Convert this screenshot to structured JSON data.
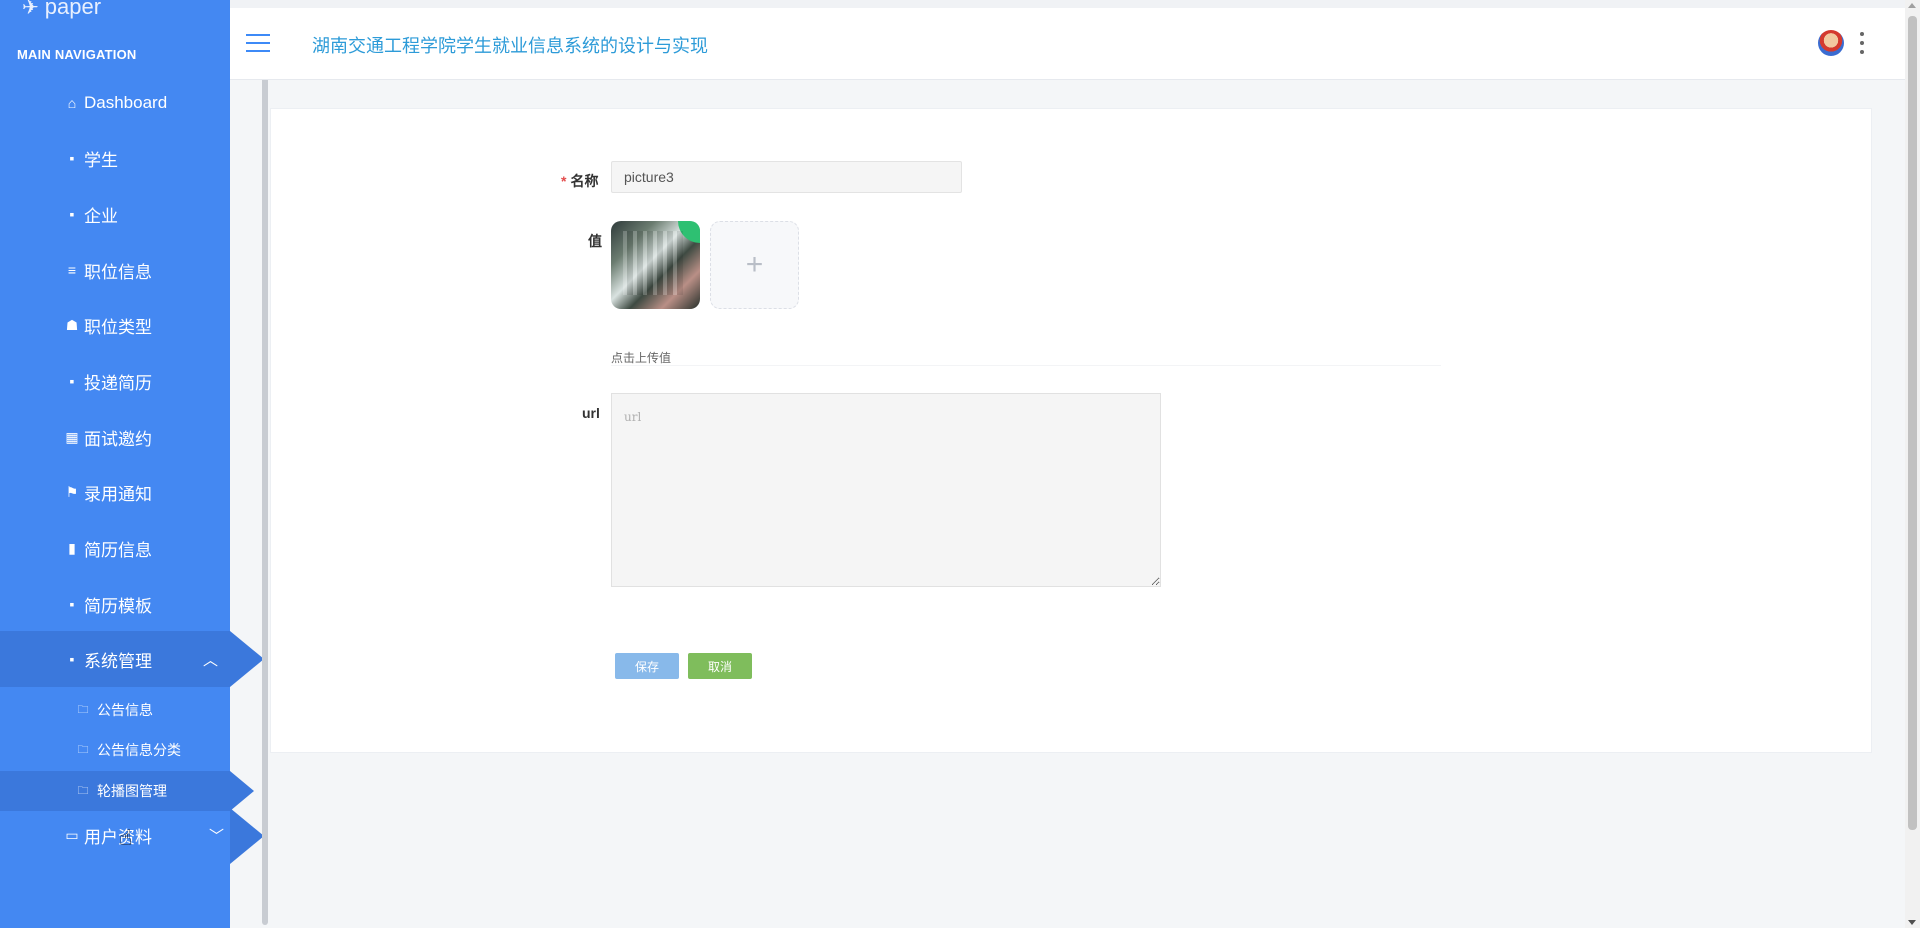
{
  "app": {
    "logo_text": "paper",
    "title": "湖南交通工程学院学生就业信息系统的设计与实现"
  },
  "sidebar": {
    "section_title": "MAIN NAVIGATION",
    "items": [
      {
        "label": "Dashboard",
        "icon": "home-icon"
      },
      {
        "label": "学生",
        "icon": "grid-icon"
      },
      {
        "label": "企业",
        "icon": "grid-icon"
      },
      {
        "label": "职位信息",
        "icon": "list-icon"
      },
      {
        "label": "职位类型",
        "icon": "tag-icon"
      },
      {
        "label": "投递简历",
        "icon": "grid-icon"
      },
      {
        "label": "面试邀约",
        "icon": "table-icon"
      },
      {
        "label": "录用通知",
        "icon": "flag-icon"
      },
      {
        "label": "简历信息",
        "icon": "clipboard-icon"
      },
      {
        "label": "简历模板",
        "icon": "grid-icon"
      },
      {
        "label": "系统管理",
        "icon": "grid-icon",
        "expanded": true
      },
      {
        "label": "用户资料",
        "icon": "card-icon",
        "expanded": false
      }
    ],
    "sub_items": [
      {
        "label": "公告信息",
        "icon": "folder-icon"
      },
      {
        "label": "公告信息分类",
        "icon": "folder-icon"
      },
      {
        "label": "轮播图管理",
        "icon": "folder-icon",
        "active": true
      }
    ]
  },
  "form": {
    "name_label": "名称",
    "name_value": "picture3",
    "value_label": "值",
    "upload_plus": "+",
    "upload_hint": "点击上传值",
    "url_label": "url",
    "url_placeholder": "url",
    "save_label": "保存",
    "cancel_label": "取消"
  },
  "colors": {
    "sidebar_bg": "#4488f2",
    "sidebar_active": "#3b78dc",
    "title_color": "#2d9bd8",
    "save_btn": "#88b9ea",
    "cancel_btn": "#7fbd5c"
  }
}
